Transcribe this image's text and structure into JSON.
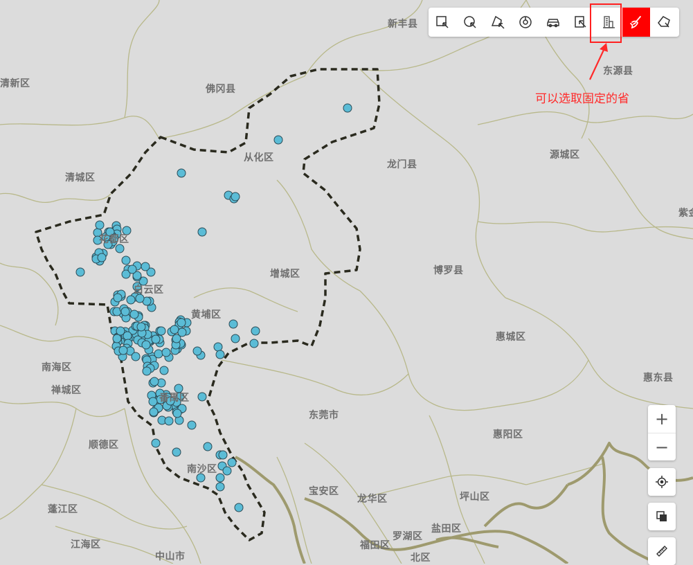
{
  "map": {
    "place_labels": [
      {
        "id": "xinfeng",
        "text": "新丰县"
      },
      {
        "id": "xinxin",
        "text": "清新区"
      },
      {
        "id": "fogang",
        "text": "佛冈县"
      },
      {
        "id": "dongyuan",
        "text": "东源县"
      },
      {
        "id": "conghua",
        "text": "从化区"
      },
      {
        "id": "qingcheng",
        "text": "清城区"
      },
      {
        "id": "longmen",
        "text": "龙门县"
      },
      {
        "id": "yuancheng",
        "text": "源城区"
      },
      {
        "id": "zijin",
        "text": "紫金"
      },
      {
        "id": "huadu",
        "text": "花都区"
      },
      {
        "id": "baiyun",
        "text": "白云区"
      },
      {
        "id": "zengcheng",
        "text": "增城区"
      },
      {
        "id": "boluo",
        "text": "博罗县"
      },
      {
        "id": "huangpu",
        "text": "黄埔区"
      },
      {
        "id": "huicheng",
        "text": "惠城区"
      },
      {
        "id": "nanhai",
        "text": "南海区"
      },
      {
        "id": "chancheng",
        "text": "禅城区"
      },
      {
        "id": "huidong",
        "text": "惠东县"
      },
      {
        "id": "panyu",
        "text": "番禺区"
      },
      {
        "id": "dongguan",
        "text": "东莞市"
      },
      {
        "id": "shunde",
        "text": "顺德区"
      },
      {
        "id": "huiyang",
        "text": "惠阳区"
      },
      {
        "id": "nansha",
        "text": "南沙区"
      },
      {
        "id": "baoan",
        "text": "宝安区"
      },
      {
        "id": "longhua",
        "text": "龙华区"
      },
      {
        "id": "pingshan",
        "text": "坪山区"
      },
      {
        "id": "pengjiang",
        "text": "蓬江区"
      },
      {
        "id": "luohu",
        "text": "罗湖区"
      },
      {
        "id": "yantian",
        "text": "盐田区"
      },
      {
        "id": "jianghai",
        "text": "江海区"
      },
      {
        "id": "futian",
        "text": "福田区"
      },
      {
        "id": "zhongshan",
        "text": "中山市"
      },
      {
        "id": "beiqu",
        "text": "北区"
      }
    ],
    "colors": {
      "background": "#dcdcdc",
      "boundary": "#b8b88a",
      "selection": "#2a2a1e",
      "points": "#5bbcd6",
      "point_stroke": "#2b4a55",
      "coast": "#9e9a6e"
    }
  },
  "toolbar": {
    "tools": [
      {
        "id": "rect-select",
        "icon": "rect-select-icon"
      },
      {
        "id": "circle-select",
        "icon": "circle-select-icon"
      },
      {
        "id": "polygon-select",
        "icon": "polygon-select-icon"
      },
      {
        "id": "radius-select",
        "icon": "radius-select-icon"
      },
      {
        "id": "route-select",
        "icon": "car-route-icon"
      },
      {
        "id": "region-select",
        "icon": "region-select-icon"
      },
      {
        "id": "province-select",
        "icon": "building-icon"
      },
      {
        "id": "clear",
        "icon": "broom-icon",
        "active": true
      },
      {
        "id": "free-select",
        "icon": "freehand-select-icon"
      }
    ]
  },
  "annotation": {
    "text": "可以选取固定的省"
  },
  "zoom": {
    "in": "+",
    "out": "−"
  }
}
